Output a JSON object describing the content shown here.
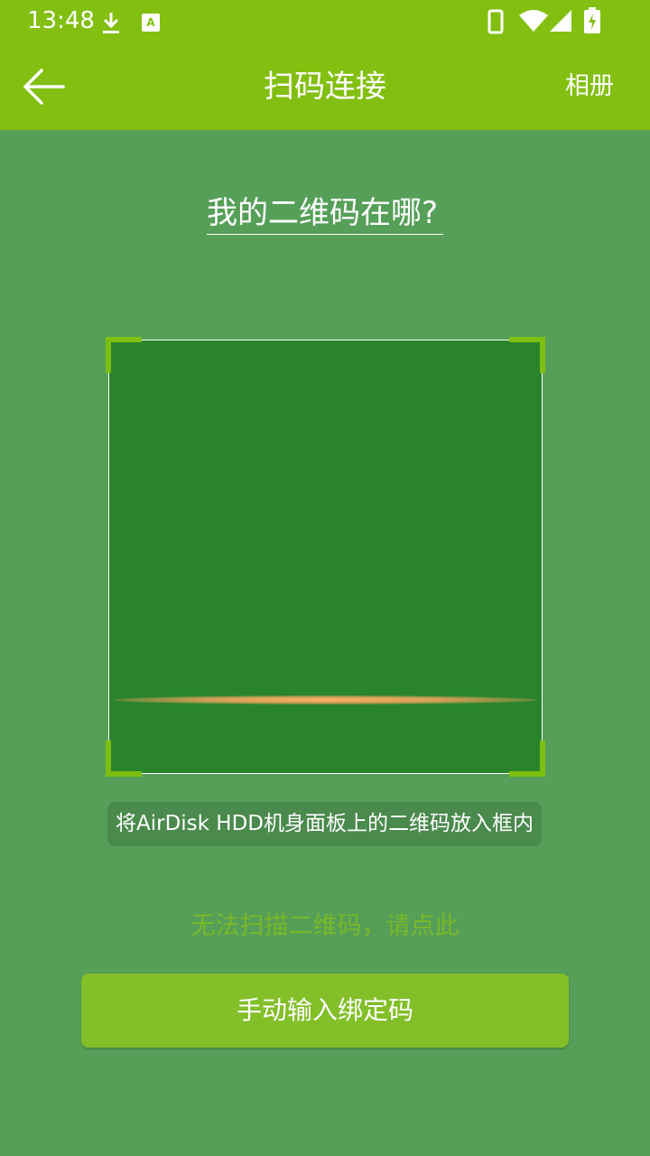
{
  "status_bar": {
    "time": "13:48",
    "icons": [
      "download-icon",
      "keyboard-a-icon",
      "phone-icon",
      "wifi-icon",
      "signal-icon",
      "battery-charging-icon"
    ]
  },
  "app_bar": {
    "back_icon": "back-arrow-icon",
    "title": "扫码连接",
    "album_label": "相册"
  },
  "where_link": "我的二维码在哪?",
  "scanner": {
    "hint": "将AirDisk HDD机身面板上的二维码放入框内"
  },
  "cannot_scan_link": "无法扫描二维码，请点此",
  "manual_button_label": "手动输入绑定码",
  "colors": {
    "app_bar": "#82bf10",
    "background": "#569f58",
    "scan_area": "#2a842b",
    "corner_accent": "#7dbf10",
    "scan_line": "#ffb266",
    "button": "#82bf28",
    "link_green": "#78b828"
  }
}
